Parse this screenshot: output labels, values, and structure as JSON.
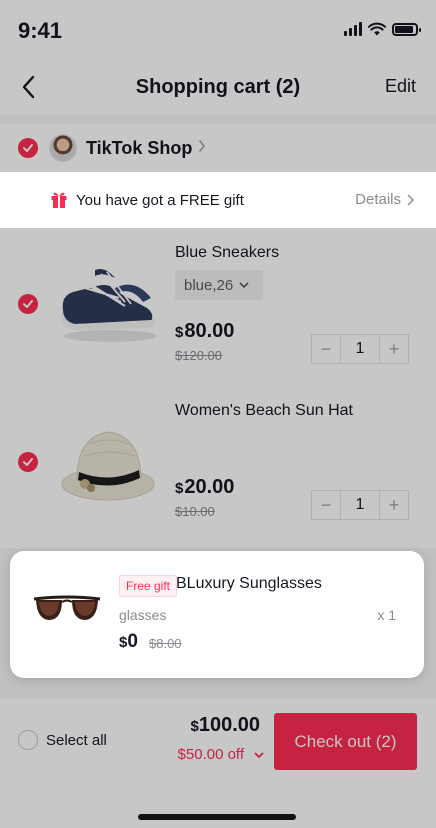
{
  "status_bar": {
    "time": "9:41"
  },
  "nav": {
    "title": "Shopping cart (2)",
    "edit_label": "Edit"
  },
  "shop": {
    "name": "TikTok Shop"
  },
  "gift_banner": {
    "text": "You have got a FREE gift",
    "details_label": "Details"
  },
  "items": [
    {
      "name": "Blue Sneakers",
      "variant": "blue,26",
      "currency": "$",
      "price": "80.00",
      "original_price": "$120.00",
      "quantity": "1",
      "selected": true,
      "icon": "sneaker-image"
    },
    {
      "name": "Women's Beach Sun Hat",
      "currency": "$",
      "price": "20.00",
      "original_price": "$10.00",
      "quantity": "1",
      "selected": true,
      "icon": "sun-hat-image"
    }
  ],
  "gift": {
    "badge": "Free gift",
    "name": "BLuxury Sunglasses",
    "variant": "glasses",
    "quantity": "x 1",
    "currency": "$",
    "price": "0",
    "original_price": "$8.00",
    "icon": "sunglasses-image"
  },
  "bottom_bar": {
    "select_all_label": "Select all",
    "currency": "$",
    "total": "100.00",
    "discount": "$50.00 off",
    "checkout_label": "Check out (2)"
  },
  "colors": {
    "accent": "#fe2c55",
    "text": "#161823",
    "muted": "#8a8b91"
  }
}
